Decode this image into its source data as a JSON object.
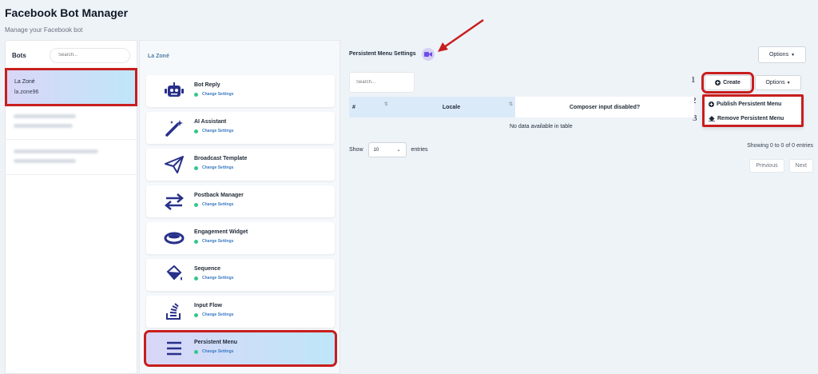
{
  "header": {
    "title": "Facebook Bot Manager",
    "subtitle": "Manage your Facebook bot"
  },
  "bots": {
    "title": "Bots",
    "search_placeholder": "Search...",
    "items": [
      {
        "name": "La Zoné",
        "handle": "la.zone96",
        "active": true
      },
      {
        "name": "",
        "handle": "",
        "blurred": true
      },
      {
        "name": "",
        "handle": "",
        "blurred": true
      }
    ]
  },
  "features": {
    "breadcrumb": "La Zoné",
    "items": [
      {
        "title": "Bot Reply",
        "status": "Change Settings",
        "icon": "robot-icon"
      },
      {
        "title": "AI Assistant",
        "status": "Change Settings",
        "icon": "magic-wand-icon"
      },
      {
        "title": "Broadcast Template",
        "status": "Change Settings",
        "icon": "paper-plane-icon"
      },
      {
        "title": "Postback Manager",
        "status": "Change Settings",
        "icon": "swap-arrows-icon"
      },
      {
        "title": "Engagement Widget",
        "status": "Change Settings",
        "icon": "ring-icon"
      },
      {
        "title": "Sequence",
        "status": "Change Settings",
        "icon": "paint-bucket-icon"
      },
      {
        "title": "Input Flow",
        "status": "Change Settings",
        "icon": "stack-icon"
      },
      {
        "title": "Persistent Menu",
        "status": "Change Settings",
        "icon": "menu-icon"
      }
    ]
  },
  "main": {
    "title": "Persistent Menu Settings",
    "options_label": "Options",
    "search_placeholder": "Search...",
    "create_label": "Create",
    "options2_label": "Options",
    "dropdown": {
      "publish": "Publish Persistent Menu",
      "remove": "Remove Persistent Menu"
    },
    "table": {
      "headers": [
        "#",
        "Locale",
        "Composer input disabled?"
      ],
      "empty": "No data available in table"
    },
    "show_label": "Show",
    "entries_value": "10",
    "entries_label": "entries",
    "showing": "Showing 0 to 0 of 0 entries",
    "prev_label": "Previous",
    "next_label": "Next"
  },
  "annotations": {
    "n1": "1",
    "n2": "2",
    "n3": "3"
  },
  "colors": {
    "highlight": "#c81e1e",
    "accent": "#27308a",
    "status_dot": "#34c78a"
  }
}
